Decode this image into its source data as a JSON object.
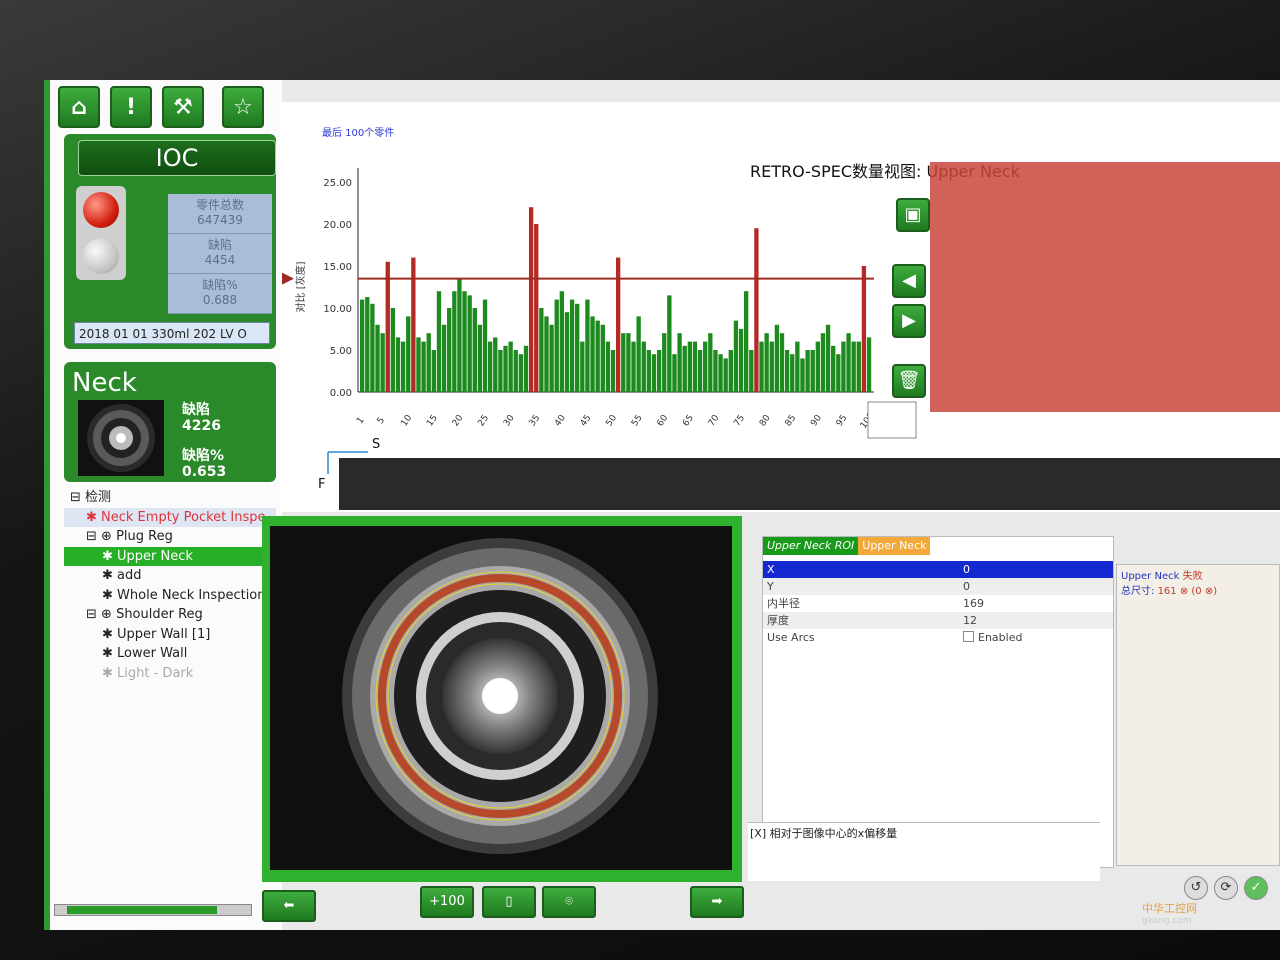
{
  "toolbar": {
    "icons": [
      "home-icon",
      "alert-icon",
      "wrench-icon",
      "star-icon"
    ],
    "alert_symbol": "!"
  },
  "ioc": {
    "title": "IOC",
    "stats": [
      {
        "label": "零件总数",
        "value": "647439"
      },
      {
        "label": "缺陷",
        "value": "4454"
      },
      {
        "label": "缺陷%",
        "value": "0.688"
      }
    ],
    "lot": "2018 01 01 330ml 202 LV O"
  },
  "neck": {
    "title": "Neck",
    "defect_label": "缺陷",
    "defect_value": "4226",
    "defect_pct_label": "缺陷%",
    "defect_pct_value": "0.653"
  },
  "tree": {
    "items": [
      {
        "label": "检测",
        "indent": 0,
        "prefix": "⊟ ",
        "style": ""
      },
      {
        "label": "Neck Empty Pocket Inspe",
        "indent": 1,
        "prefix": "✱ ",
        "style": "red"
      },
      {
        "label": "Plug Reg",
        "indent": 1,
        "prefix": "⊟ ⊕ ",
        "style": ""
      },
      {
        "label": "Upper Neck",
        "indent": 2,
        "prefix": "✱ ",
        "style": "sel"
      },
      {
        "label": "add",
        "indent": 2,
        "prefix": "✱ ",
        "style": ""
      },
      {
        "label": "Whole Neck Inspection",
        "indent": 2,
        "prefix": "✱ ",
        "style": ""
      },
      {
        "label": "Shoulder Reg",
        "indent": 1,
        "prefix": "⊟ ⊕ ",
        "style": ""
      },
      {
        "label": "Upper Wall [1]",
        "indent": 2,
        "prefix": "✱ ",
        "style": ""
      },
      {
        "label": "Lower Wall",
        "indent": 2,
        "prefix": "✱ ",
        "style": ""
      },
      {
        "label": "Light - Dark",
        "indent": 2,
        "prefix": "✱ ",
        "style": "dim"
      }
    ]
  },
  "chart": {
    "header": "最后 100个零件",
    "title": "RETRO-SPEC数量视图:  Upper Neck",
    "axis_s": "S",
    "axis_f": "F",
    "colors": {
      "ok": "#1c8a1c",
      "reject": "#b52a24",
      "threshold": "#9e2a22"
    }
  },
  "chart_data": {
    "type": "bar",
    "title": "RETRO-SPEC数量视图:  Upper Neck",
    "ylabel": "对比 [灰度]",
    "ylim": [
      0,
      25
    ],
    "yticks": [
      "25.00",
      "20.00",
      "15.00",
      "10.00",
      "5.00",
      "0.00"
    ],
    "xticks": [
      "1",
      "5",
      "10",
      "15",
      "20",
      "25",
      "30",
      "35",
      "40",
      "45",
      "50",
      "55",
      "60",
      "65",
      "70",
      "75",
      "80",
      "85",
      "90",
      "95",
      "100"
    ],
    "threshold": 13.5,
    "values": [
      11,
      11.3,
      10.5,
      8,
      7,
      15.5,
      10,
      6.5,
      6,
      9,
      16,
      6.5,
      6,
      7,
      5,
      12,
      8,
      10,
      12,
      13.5,
      12,
      11.5,
      10,
      8,
      11,
      6,
      6.5,
      5,
      5.5,
      6,
      5,
      4.5,
      5.5,
      22,
      20,
      10,
      9,
      8,
      11,
      12,
      9.5,
      11,
      10.5,
      6,
      11,
      9,
      8.5,
      8,
      6,
      5,
      16,
      7,
      7,
      6,
      9,
      6,
      5,
      4.5,
      5,
      7,
      11.5,
      4.5,
      7,
      5.5,
      6,
      6,
      5,
      6,
      7,
      5,
      4.5,
      4,
      5,
      8.5,
      7.5,
      12,
      5,
      19.5,
      6,
      7,
      6,
      8,
      7,
      5,
      4.5,
      6,
      4,
      5,
      5,
      6,
      7,
      8,
      5.5,
      4.5,
      6,
      7,
      6,
      6,
      15,
      6.5
    ]
  },
  "image_view": {
    "tag": "tracked"
  },
  "bottom_buttons": {
    "left_arrow": "⬅",
    "plus100": "+100",
    "video": "▯",
    "camera": "⌾",
    "right_arrow": "➡"
  },
  "props": {
    "tab_active": "Upper Neck ROI",
    "tab_other": "Upper Neck",
    "rows": [
      {
        "key": "X",
        "value": "0"
      },
      {
        "key": "Y",
        "value": "0"
      },
      {
        "key": "内半径",
        "value": "169"
      },
      {
        "key": "厚度",
        "value": "12"
      },
      {
        "key": "Use Arcs",
        "value": "Enabled"
      }
    ],
    "description": "[X] 相对于图像中心的x偏移量"
  },
  "result": {
    "line1_a": "Upper Neck",
    "line1_b": "失败",
    "line2_a": "总尺寸:",
    "line2_b": "161 ⊗ (0 ⊗)"
  },
  "watermark": {
    "line1": "中华工控网",
    "line2": "gkong.com"
  }
}
